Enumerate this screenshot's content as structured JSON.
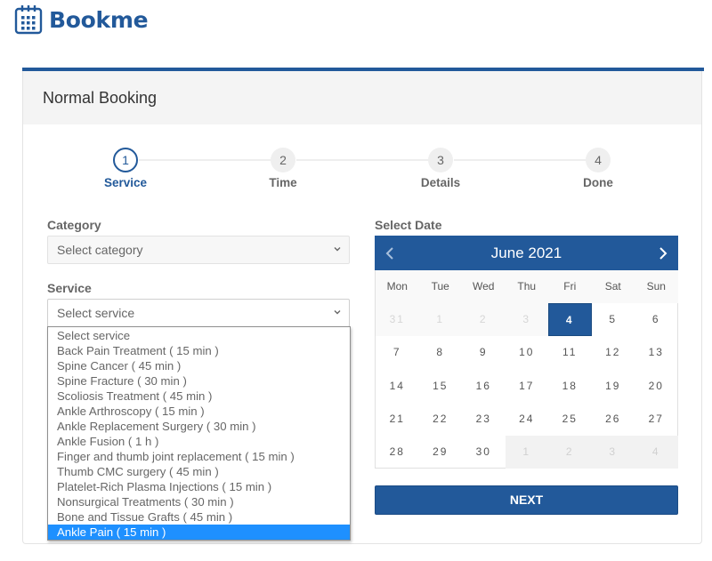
{
  "brand": {
    "name": "Bookme",
    "icon": "calendar-icon",
    "color": "#22599a"
  },
  "card": {
    "title": "Normal Booking"
  },
  "steps": [
    {
      "number": "1",
      "label": "Service",
      "active": true
    },
    {
      "number": "2",
      "label": "Time",
      "active": false
    },
    {
      "number": "3",
      "label": "Details",
      "active": false
    },
    {
      "number": "4",
      "label": "Done",
      "active": false
    }
  ],
  "form": {
    "category": {
      "label": "Category",
      "value": "Select category"
    },
    "service": {
      "label": "Service",
      "value": "Select service",
      "options": [
        "Select service",
        "Back Pain Treatment ( 15 min )",
        "Spine Cancer ( 45 min )",
        "Spine Fracture ( 30 min )",
        "Scoliosis Treatment ( 45 min )",
        "Ankle Arthroscopy ( 15 min )",
        "Ankle Replacement Surgery ( 30 min )",
        "Ankle Fusion ( 1 h )",
        "Finger and thumb joint replacement ( 15 min )",
        "Thumb CMC surgery ( 45 min )",
        "Platelet-Rich Plasma Injections ( 15 min )",
        "Nonsurgical Treatments ( 30 min )",
        "Bone and Tissue Grafts ( 45 min )",
        "Ankle Pain ( 15 min )"
      ],
      "highlighted_index": 13
    }
  },
  "calendar": {
    "label": "Select Date",
    "month_title": "June 2021",
    "prev_icon": "chevron-left-icon",
    "next_icon": "chevron-right-icon",
    "weekdays": [
      "Mon",
      "Tue",
      "Wed",
      "Thu",
      "Fri",
      "Sat",
      "Sun"
    ],
    "weeks": [
      [
        {
          "d": "31",
          "s": "muted"
        },
        {
          "d": "1",
          "s": "muted"
        },
        {
          "d": "2",
          "s": "muted"
        },
        {
          "d": "3",
          "s": "muted"
        },
        {
          "d": "4",
          "s": "selected"
        },
        {
          "d": "5",
          "s": ""
        },
        {
          "d": "6",
          "s": ""
        }
      ],
      [
        {
          "d": "7",
          "s": ""
        },
        {
          "d": "8",
          "s": ""
        },
        {
          "d": "9",
          "s": ""
        },
        {
          "d": "10",
          "s": ""
        },
        {
          "d": "11",
          "s": ""
        },
        {
          "d": "12",
          "s": ""
        },
        {
          "d": "13",
          "s": ""
        }
      ],
      [
        {
          "d": "14",
          "s": ""
        },
        {
          "d": "15",
          "s": ""
        },
        {
          "d": "16",
          "s": ""
        },
        {
          "d": "17",
          "s": ""
        },
        {
          "d": "18",
          "s": ""
        },
        {
          "d": "19",
          "s": ""
        },
        {
          "d": "20",
          "s": ""
        }
      ],
      [
        {
          "d": "21",
          "s": ""
        },
        {
          "d": "22",
          "s": ""
        },
        {
          "d": "23",
          "s": ""
        },
        {
          "d": "24",
          "s": ""
        },
        {
          "d": "25",
          "s": ""
        },
        {
          "d": "26",
          "s": ""
        },
        {
          "d": "27",
          "s": ""
        }
      ],
      [
        {
          "d": "28",
          "s": ""
        },
        {
          "d": "29",
          "s": ""
        },
        {
          "d": "30",
          "s": ""
        },
        {
          "d": "1",
          "s": "next-month"
        },
        {
          "d": "2",
          "s": "next-month"
        },
        {
          "d": "3",
          "s": "next-month"
        },
        {
          "d": "4",
          "s": "next-month"
        }
      ]
    ],
    "selected_date": "4"
  },
  "buttons": {
    "next_label": "NEXT"
  }
}
